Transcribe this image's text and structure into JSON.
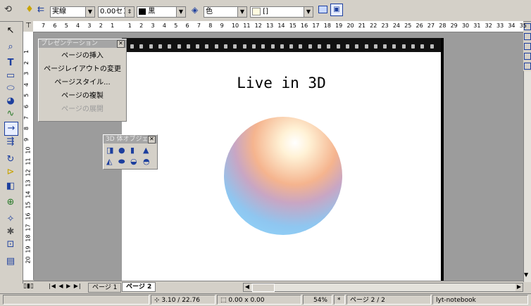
{
  "toolbar": {
    "line_style": "実線",
    "line_width": "0.00セン",
    "line_color": "黒",
    "area_style": "色",
    "area_fill": "[]"
  },
  "ruler": {
    "h_ticks": [
      "7",
      "6",
      "5",
      "4",
      "3",
      "2",
      "1",
      "1",
      "2",
      "3",
      "4",
      "5",
      "6",
      "7",
      "8",
      "9",
      "10",
      "11",
      "12",
      "13",
      "14",
      "15",
      "16",
      "17",
      "18",
      "19",
      "20",
      "21",
      "22",
      "23",
      "24",
      "25",
      "26",
      "27",
      "28",
      "29",
      "30",
      "31",
      "32",
      "33",
      "34",
      "35"
    ],
    "v_ticks": [
      "1",
      "2",
      "3",
      "4",
      "5",
      "6",
      "7",
      "8",
      "9",
      "10",
      "11",
      "12",
      "13",
      "14",
      "15",
      "16",
      "17",
      "18",
      "19",
      "20"
    ]
  },
  "presentation_panel": {
    "title": "プレゼンテーション",
    "items": [
      "ページの挿入",
      "ページレイアウトの変更",
      "ページスタイル...",
      "ページの複製",
      "ページの展開"
    ]
  },
  "objects3d_panel": {
    "title": "3D 体オブジェ"
  },
  "slide": {
    "title": "Live in 3D"
  },
  "tabs": [
    "ページ 1",
    "ページ 2"
  ],
  "status": {
    "position": "3.10 / 22.76",
    "size": "0.00 x 0.00",
    "zoom": "54%",
    "modified": "*",
    "page": "ページ 2 / 2",
    "template": "lyt-notebook"
  }
}
